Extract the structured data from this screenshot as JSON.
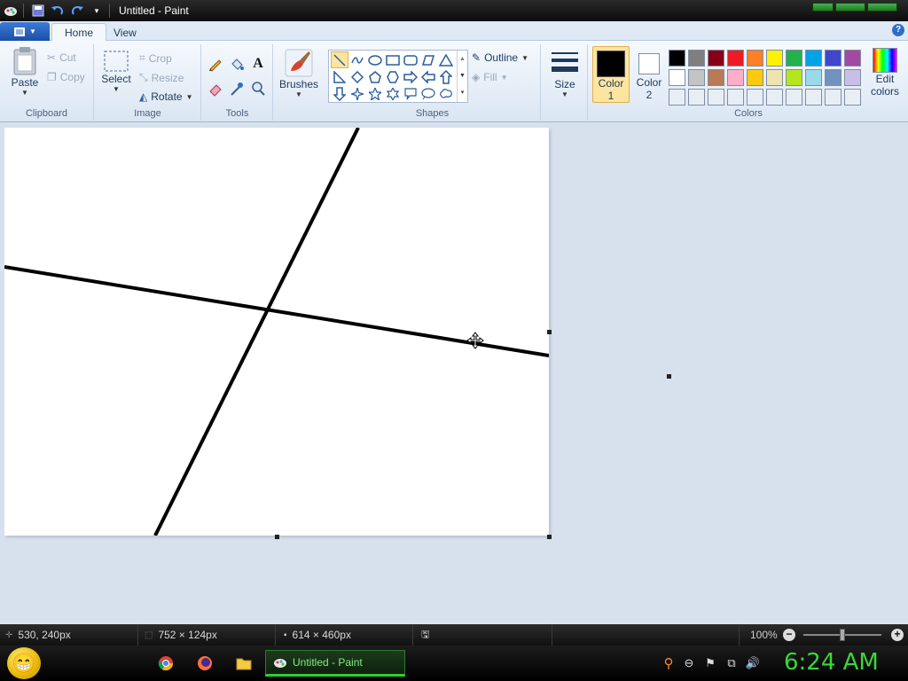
{
  "window": {
    "title": "Untitled - Paint"
  },
  "qat": {
    "icons": [
      "paint-app-icon",
      "save-icon",
      "undo-icon",
      "redo-icon",
      "customize-qat-icon"
    ]
  },
  "tabs": {
    "file_label": "",
    "home": "Home",
    "view": "View"
  },
  "clipboard": {
    "paste": "Paste",
    "cut": "Cut",
    "copy": "Copy",
    "label": "Clipboard"
  },
  "image": {
    "select": "Select",
    "crop": "Crop",
    "resize": "Resize",
    "rotate": "Rotate",
    "label": "Image"
  },
  "tools": {
    "label": "Tools",
    "text_glyph": "A"
  },
  "brushes": {
    "label": "Brushes"
  },
  "shapes": {
    "outline": "Outline",
    "fill": "Fill",
    "label": "Shapes"
  },
  "size": {
    "label": "Size"
  },
  "colors": {
    "color1_line1": "Color",
    "color1_line2": "1",
    "color2_line1": "Color",
    "color2_line2": "2",
    "edit_line1": "Edit",
    "edit_line2": "colors",
    "label": "Colors",
    "color1_value": "#000000",
    "color2_value": "#ffffff",
    "palette_row1": [
      "#000000",
      "#7f7f7f",
      "#880015",
      "#ed1c24",
      "#ff7f27",
      "#fff200",
      "#22b14c",
      "#00a2e8",
      "#3f48cc",
      "#a349a4"
    ],
    "palette_row2": [
      "#ffffff",
      "#c3c3c3",
      "#b97a57",
      "#ffaec9",
      "#ffc90e",
      "#efe4b0",
      "#b5e61d",
      "#99d9ea",
      "#7092be",
      "#c8bfe7"
    ],
    "palette_row3": [
      "",
      "",
      "",
      "",
      "",
      "",
      "",
      "",
      "",
      ""
    ]
  },
  "status": {
    "cursor_pos": "530, 240px",
    "selection_size": "752 × 124px",
    "image_size": "614 × 460px",
    "zoom": "100%"
  },
  "taskbar": {
    "task_label": "Untitled - Paint",
    "clock": "6:24 AM"
  }
}
